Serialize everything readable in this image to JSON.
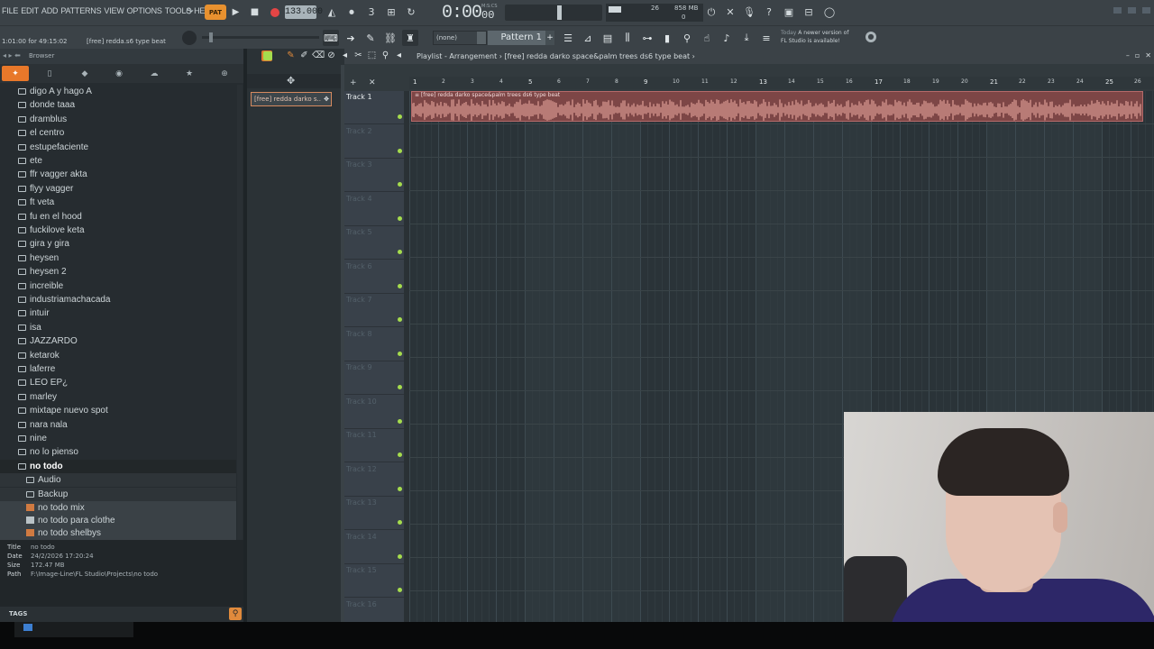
{
  "menu": [
    "FILE",
    "EDIT",
    "ADD",
    "PATTERNS",
    "VIEW",
    "OPTIONS",
    "TOOLS",
    "HELP"
  ],
  "transport": {
    "pattern_song_label": "PAT",
    "tempo": "133.000",
    "time": "0:00",
    "time_small": "00",
    "time_unit": "M:S:CS",
    "cpu_num": "26",
    "memory": "858 MB",
    "polyphony": "0"
  },
  "hint": {
    "position": "1:01:00 for 49:15:02",
    "clip": "[free] redda.s6 type beat"
  },
  "toolbar2": {
    "snap": "(none)",
    "pattern": "Pattern 1",
    "pattern_add": "+"
  },
  "news": {
    "date": "Today",
    "line1": "A newer version of",
    "line2": "FL Studio is available!"
  },
  "browser": {
    "title": "Browser",
    "folders": [
      "digo A y hago A",
      "donde taaa",
      "dramblus",
      "el centro",
      "estupefaciente",
      "ete",
      "ffr vagger akta",
      "flyy vagger",
      "ft veta",
      "fu en el hood",
      "fuckilove keta",
      "gira y gira",
      "heysen",
      "heysen 2",
      "increible",
      "industriamachacada",
      "intuir",
      "isa",
      "JAZZARDO",
      "ketarok",
      "laferre",
      "LEO EP¿",
      "marley",
      "mixtape nuevo spot",
      "nara nala",
      "nine",
      "no lo pienso"
    ],
    "selected_folder": "no todo",
    "subfolders": [
      "Audio",
      "Backup"
    ],
    "files": [
      {
        "name": "no todo mix",
        "icon": "project-icon"
      },
      {
        "name": "no todo para clothe",
        "icon": "file-icon"
      },
      {
        "name": "no todo shelbys",
        "icon": "project-icon"
      }
    ],
    "info": {
      "title_label": "Title",
      "title": "no todo",
      "date_label": "Date",
      "date": "24/2/2026 17:20:24",
      "size_label": "Size",
      "size": "172.47 MB",
      "path_label": "Path",
      "path": "F:\\Image-Line\\FL Studio\\Projects\\no todo"
    },
    "tags_label": "TAGS"
  },
  "picker": {
    "clip_name": "[free] redda  darko  s..",
    "add_symbol": "✥"
  },
  "playlist": {
    "title": "Playlist - Arrangement › [free] redda  darko  space&palm trees  ds6 type beat ›",
    "clip_label": "≡ [free] redda  darko  space&palm trees  ds6 type beat",
    "ruler": [
      "1",
      "2",
      "3",
      "4",
      "5",
      "6",
      "7",
      "8",
      "9",
      "10",
      "11",
      "12",
      "13",
      "14",
      "15",
      "16",
      "17",
      "18",
      "19",
      "20",
      "21",
      "22",
      "23",
      "24",
      "25",
      "26"
    ],
    "tracks": [
      "Track 1",
      "Track 2",
      "Track 3",
      "Track 4",
      "Track 5",
      "Track 6",
      "Track 7",
      "Track 8",
      "Track 9",
      "Track 10",
      "Track 11",
      "Track 12",
      "Track 13",
      "Track 14",
      "Track 15",
      "Track 16"
    ]
  },
  "colors": {
    "accent": "#e8782a",
    "clip": "#7d4646",
    "track_led": "#a5dc4d",
    "record": "#e44545"
  }
}
